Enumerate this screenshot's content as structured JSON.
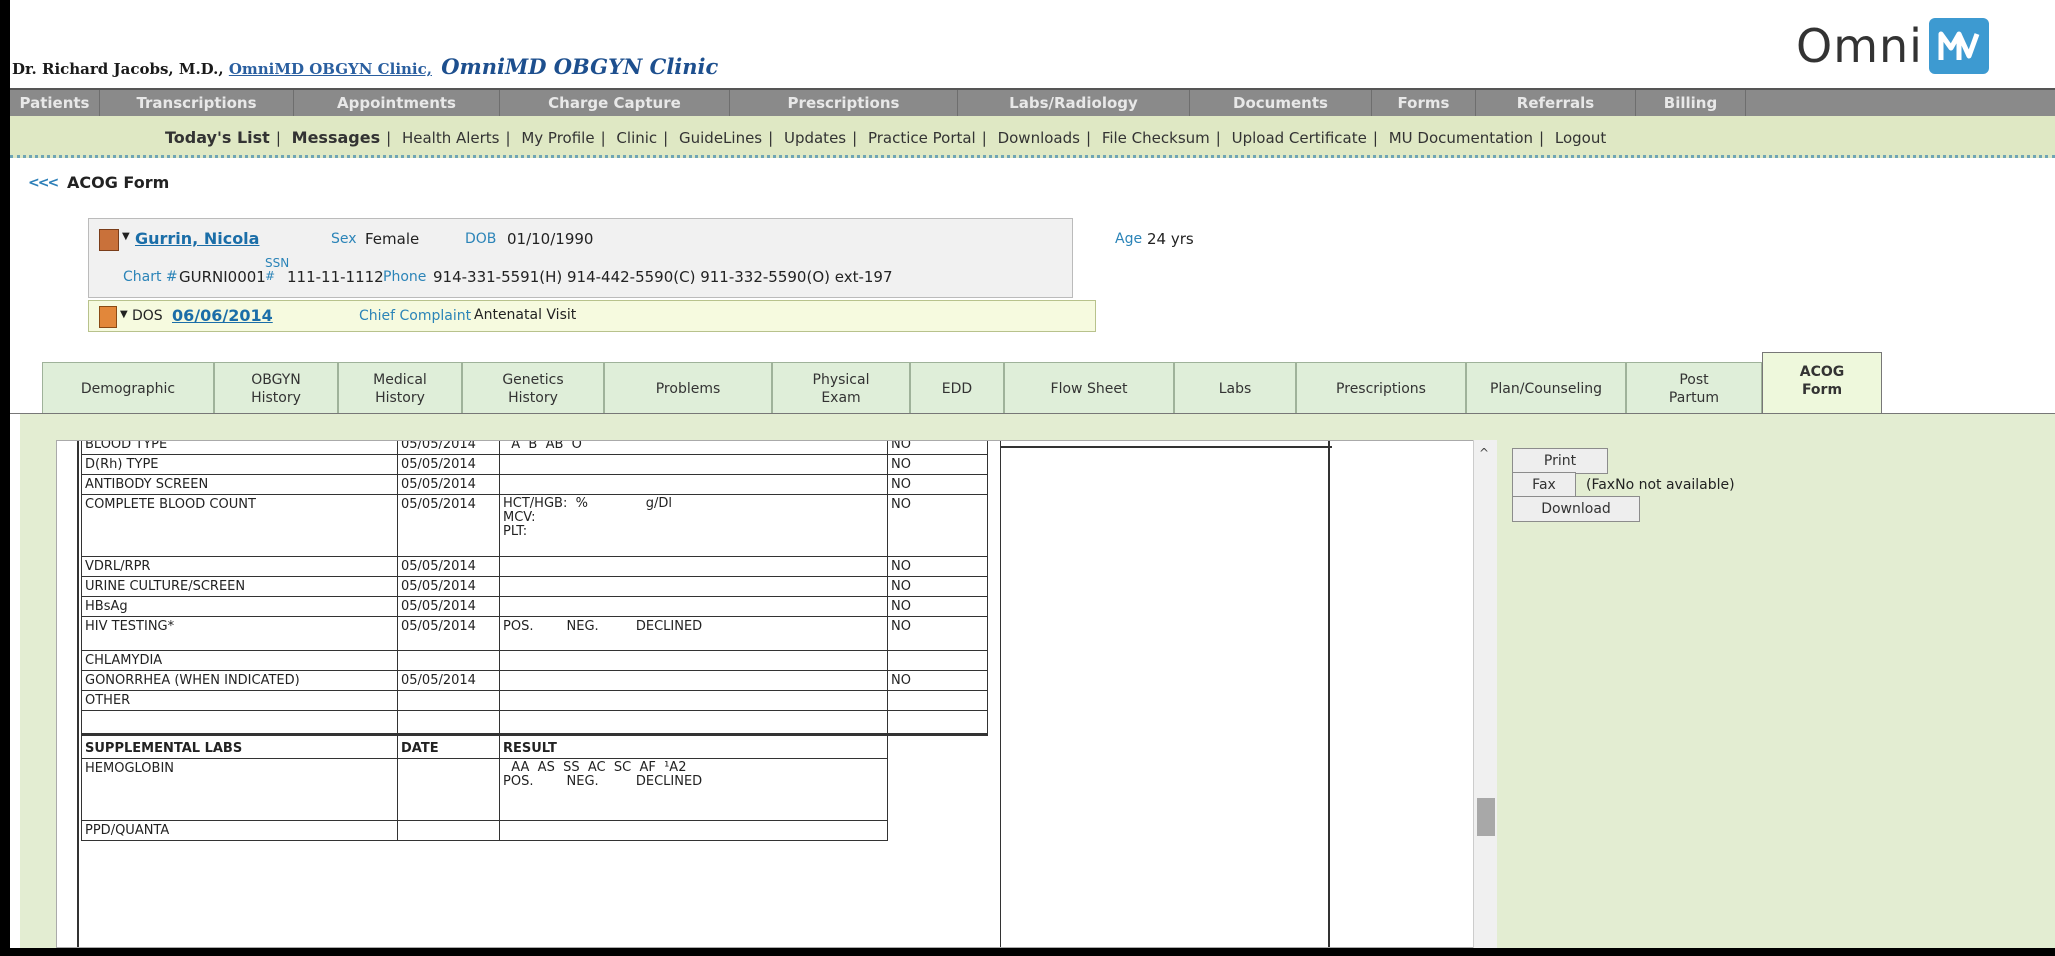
{
  "header": {
    "doctor": "Dr. Richard Jacobs, M.D.,",
    "clinic_link": "OmniMD OBGYN Clinic,",
    "clinic_title": "OmniMD OBGYN Clinic",
    "logo_text": "Omni",
    "logo_icon": "omnimd-logo-icon"
  },
  "main_nav": [
    "Patients",
    "Transcriptions",
    "Appointments",
    "Charge Capture",
    "Prescriptions",
    "Labs/Radiology",
    "Documents",
    "Forms",
    "Referrals",
    "Billing"
  ],
  "sub_nav": [
    "Today's List",
    "Messages",
    "Health Alerts",
    "My Profile",
    "Clinic",
    "GuideLines",
    "Updates",
    "Practice Portal",
    "Downloads",
    "File Checksum",
    "Upload Certificate",
    "MU Documentation",
    "Logout"
  ],
  "page": {
    "back": "<<<",
    "title": "ACOG Form"
  },
  "patient": {
    "name": "Gurrin, Nicola",
    "sex_label": "Sex",
    "sex": "Female",
    "dob_label": "DOB",
    "dob": "01/10/1990",
    "age_label": "Age",
    "age": "24 yrs",
    "chart_label": "Chart #",
    "chart": "GURNI0001",
    "ssn_label": "SSN #",
    "ssn": "111-11-1112",
    "phone_label": "Phone",
    "phone": "914-331-5591(H)   914-442-5590(C)   911-332-5590(O) ext-197",
    "dos_label": "DOS",
    "dos": "06/06/2014",
    "complaint_label": "Chief Complaint",
    "complaint": "Antenatal Visit"
  },
  "tabs": [
    {
      "l1": "Demographic",
      "l2": ""
    },
    {
      "l1": "OBGYN",
      "l2": "History"
    },
    {
      "l1": "Medical",
      "l2": "History"
    },
    {
      "l1": "Genetics",
      "l2": "History"
    },
    {
      "l1": "Problems",
      "l2": ""
    },
    {
      "l1": "Physical",
      "l2": "Exam"
    },
    {
      "l1": "EDD",
      "l2": ""
    },
    {
      "l1": "Flow Sheet",
      "l2": ""
    },
    {
      "l1": "Labs",
      "l2": ""
    },
    {
      "l1": "Prescriptions",
      "l2": ""
    },
    {
      "l1": "Plan/Counseling",
      "l2": ""
    },
    {
      "l1": "Post",
      "l2": "Partum"
    },
    {
      "l1": "ACOG",
      "l2": "Form"
    }
  ],
  "actions": {
    "print": "Print",
    "fax": "Fax",
    "fax_note": "(FaxNo not available)",
    "download": "Download"
  },
  "labs_table": {
    "rows": [
      {
        "test": "BLOOD TYPE",
        "date": "05/05/2014",
        "result": "  A  B  AB  O",
        "reviewed": "NO"
      },
      {
        "test": "D(Rh) TYPE",
        "date": "05/05/2014",
        "result": "",
        "reviewed": "NO"
      },
      {
        "test": "ANTIBODY SCREEN",
        "date": "05/05/2014",
        "result": "",
        "reviewed": "NO"
      },
      {
        "test": "COMPLETE BLOOD COUNT",
        "date": "05/05/2014",
        "result": "HCT/HGB:  %              g/Dl\nMCV:\nPLT:",
        "reviewed": "NO"
      },
      {
        "test": "VDRL/RPR",
        "date": "05/05/2014",
        "result": "",
        "reviewed": "NO"
      },
      {
        "test": "URINE CULTURE/SCREEN",
        "date": "05/05/2014",
        "result": "",
        "reviewed": "NO"
      },
      {
        "test": "HBsAg",
        "date": "05/05/2014",
        "result": "",
        "reviewed": "NO"
      },
      {
        "test": "HIV TESTING*",
        "date": "05/05/2014",
        "result": "POS.        NEG.         DECLINED",
        "reviewed": "NO"
      },
      {
        "test": "CHLAMYDIA",
        "date": "",
        "result": "",
        "reviewed": ""
      },
      {
        "test": "GONORRHEA (WHEN INDICATED)",
        "date": "05/05/2014",
        "result": "",
        "reviewed": "NO"
      },
      {
        "test": "OTHER",
        "date": "",
        "result": "",
        "reviewed": ""
      },
      {
        "test": "",
        "date": "",
        "result": "",
        "reviewed": ""
      }
    ],
    "supplemental_header": {
      "test": "SUPPLEMENTAL LABS",
      "date": "DATE",
      "result": "RESULT"
    },
    "supplemental_rows": [
      {
        "test": "HEMOGLOBIN",
        "date": "",
        "result": "  AA  AS  SS  AC  SC  AF  ¹A2\nPOS.        NEG.         DECLINED"
      },
      {
        "test": "PPD/QUANTA",
        "date": "",
        "result": ""
      }
    ]
  }
}
